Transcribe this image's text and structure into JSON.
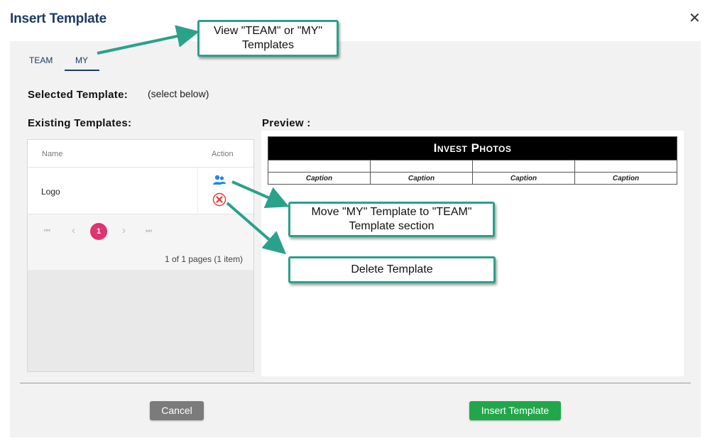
{
  "dialog": {
    "title": "Insert Template",
    "close_glyph": "✕"
  },
  "tabs": [
    {
      "label": "TEAM"
    },
    {
      "label": "MY"
    }
  ],
  "selected": {
    "label": "Selected Template:",
    "hint": "(select below)"
  },
  "existing": {
    "label": "Existing Templates:",
    "columns": {
      "name": "Name",
      "action": "Action"
    },
    "rows": [
      {
        "name": "Logo",
        "actions": [
          "move-to-team-icon",
          "delete-icon"
        ]
      }
    ]
  },
  "pagination": {
    "first": "⏮",
    "prev": "‹",
    "current": "1",
    "next": "›",
    "last": "⏭",
    "info": "1 of 1 pages (1 item)"
  },
  "preview": {
    "label": "Preview :",
    "header": "Invest Photos",
    "captions": [
      "Caption",
      "Caption",
      "Caption",
      "Caption"
    ]
  },
  "buttons": {
    "cancel": "Cancel",
    "insert": "Insert Template"
  },
  "callouts": {
    "view": "View \"TEAM\" or \"MY\" Templates",
    "move": "Move \"MY\" Template to \"TEAM\" Template section",
    "delete": "Delete Template"
  },
  "colors": {
    "accent": "#1d3a66",
    "callout_border": "#2aa18a",
    "insert": "#22a64a",
    "cancel": "#7b7b7b",
    "page_active": "#e0336f",
    "delete": "#e53935",
    "move": "#1e88e5"
  }
}
